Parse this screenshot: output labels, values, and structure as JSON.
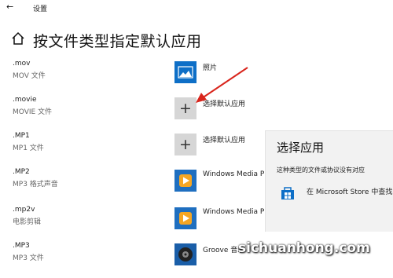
{
  "window": {
    "title": "设置"
  },
  "header": {
    "title": "按文件类型指定默认应用"
  },
  "rows": [
    {
      "ext": ".mov",
      "type": "MOV 文件",
      "app": "照片",
      "icon": "photos-icon"
    },
    {
      "ext": ".movie",
      "type": "MOVIE 文件",
      "app": "选择默认应用",
      "icon": "plus-icon"
    },
    {
      "ext": ".MP1",
      "type": "MP1 文件",
      "app": "选择默认应用",
      "icon": "plus-icon"
    },
    {
      "ext": ".MP2",
      "type": "MP3 格式声音",
      "app": "Windows Media P",
      "icon": "windows-media-player-icon"
    },
    {
      "ext": ".mp2v",
      "type": "电影剪辑",
      "app": "Windows Media P",
      "icon": "windows-media-player-icon"
    },
    {
      "ext": ".MP3",
      "type": "MP3 文件",
      "app": "Groove 音乐",
      "icon": "groove-music-icon"
    }
  ],
  "choose_app_panel": {
    "title": "选择应用",
    "description": "这种类型的文件或协议没有对应",
    "store_option": "在 Microsoft Store 中查找"
  },
  "watermark": "sichuanhong.com",
  "colors": {
    "accent": "#0e6fc7",
    "arrow": "#d9251c",
    "panel_bg": "#f2f2f2"
  }
}
